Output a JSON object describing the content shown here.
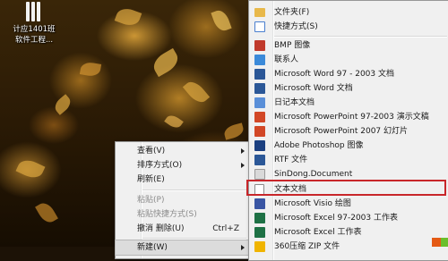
{
  "desktop": {
    "icon_label_line1": "计应1401班",
    "icon_label_line2": "软件工程...",
    "icon": "folder-stack-icon"
  },
  "context_menu": {
    "items": [
      {
        "label": "查看(V)",
        "submenu": true
      },
      {
        "label": "排序方式(O)",
        "submenu": true
      },
      {
        "label": "刷新(E)"
      },
      {
        "label": "粘贴(P)",
        "disabled": true
      },
      {
        "label": "粘贴快捷方式(S)",
        "disabled": true
      },
      {
        "label": "撤消 删除(U)",
        "shortcut": "Ctrl+Z"
      },
      {
        "label": "新建(W)",
        "submenu": true
      }
    ]
  },
  "new_submenu": {
    "items": [
      {
        "label": "文件夹(F)",
        "icon": "folder-icon",
        "color": "#e8b84a"
      },
      {
        "label": "快捷方式(S)",
        "icon": "shortcut-icon",
        "color": "#4a7fcf"
      },
      {
        "label": "BMP 图像",
        "icon": "bmp-image-icon",
        "color": "#c0392b"
      },
      {
        "label": "联系人",
        "icon": "contact-icon",
        "color": "#3b8ad9"
      },
      {
        "label": "Microsoft Word 97 - 2003 文档",
        "icon": "word-doc-icon",
        "color": "#2b5797"
      },
      {
        "label": "Microsoft Word 文档",
        "icon": "word-docx-icon",
        "color": "#2b5797"
      },
      {
        "label": "日记本文档",
        "icon": "journal-icon",
        "color": "#5a8fd8"
      },
      {
        "label": "Microsoft PowerPoint 97-2003 演示文稿",
        "icon": "ppt-icon",
        "color": "#d24726"
      },
      {
        "label": "Microsoft PowerPoint 2007 幻灯片",
        "icon": "pptx-icon",
        "color": "#d24726"
      },
      {
        "label": "Adobe Photoshop 图像",
        "icon": "photoshop-icon",
        "color": "#1b3f80"
      },
      {
        "label": "RTF 文件",
        "icon": "rtf-icon",
        "color": "#2b5797"
      },
      {
        "label": "SinDong.Document",
        "icon": "document-icon",
        "color": "#d9d9d9"
      },
      {
        "label": "文本文档",
        "icon": "text-document-icon",
        "color": "#ffffff"
      },
      {
        "label": "Microsoft Visio 绘图",
        "icon": "visio-icon",
        "color": "#3955a3"
      },
      {
        "label": "Microsoft Excel 97-2003 工作表",
        "icon": "excel-icon",
        "color": "#1e7145"
      },
      {
        "label": "Microsoft Excel 工作表",
        "icon": "excel-xlsx-icon",
        "color": "#1e7145"
      },
      {
        "label": "360压缩 ZIP 文件",
        "icon": "zip-icon",
        "color": "#f0b400"
      }
    ],
    "highlighted_index": 12,
    "highlight_color": "#c8262a"
  }
}
